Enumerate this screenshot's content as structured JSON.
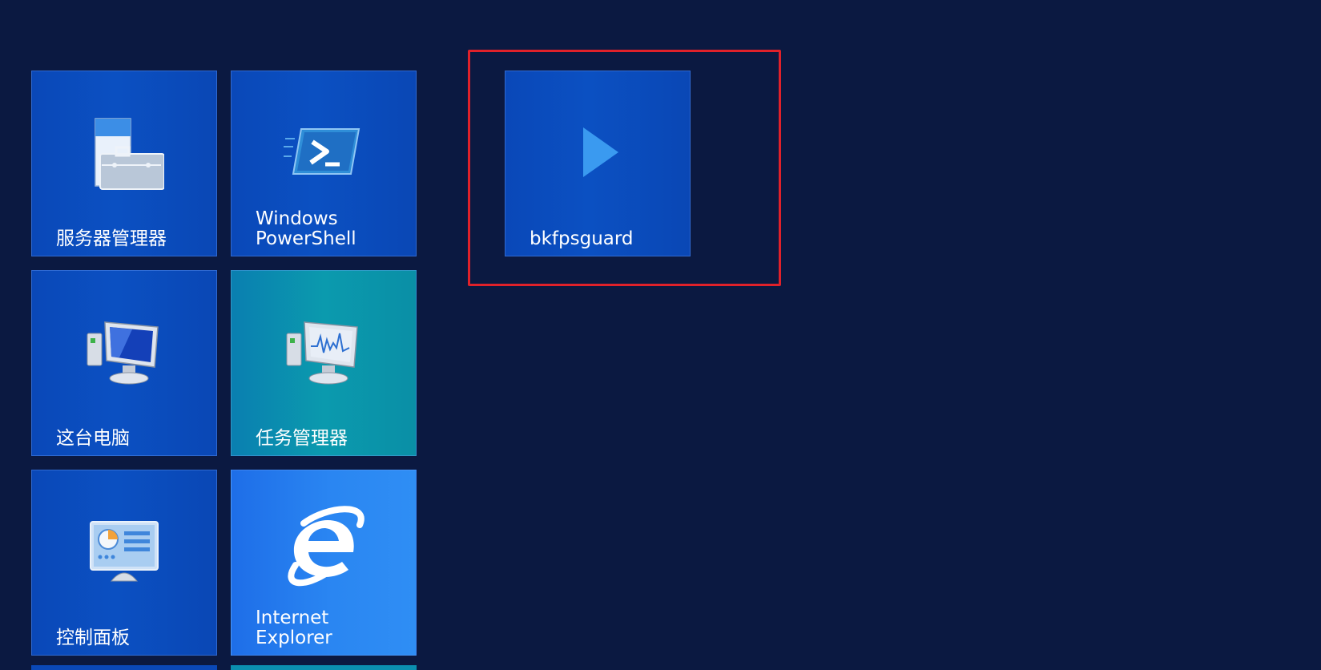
{
  "tiles": [
    {
      "label": "服务器管理器",
      "icon": "server-manager-icon"
    },
    {
      "label": "Windows\nPowerShell",
      "icon": "powershell-icon"
    },
    {
      "label": "这台电脑",
      "icon": "this-pc-icon"
    },
    {
      "label": "任务管理器",
      "icon": "task-manager-icon"
    },
    {
      "label": "控制面板",
      "icon": "control-panel-icon"
    },
    {
      "label": "Internet\nExplorer",
      "icon": "internet-explorer-icon"
    },
    {
      "label": "bkfpsguard",
      "icon": "play-icon"
    }
  ],
  "colors": {
    "background": "#0b1941",
    "tile_blue": "#0b50c2",
    "tile_teal": "#0b9aae",
    "tile_bright": "#2a86f2",
    "highlight": "#e0212a"
  }
}
